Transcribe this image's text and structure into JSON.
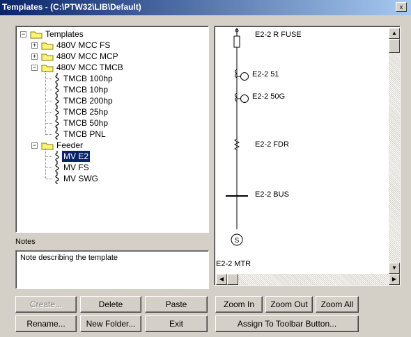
{
  "window": {
    "title": "Templates - (C:\\PTW32\\LIB\\Default)",
    "close_glyph": "x"
  },
  "tree": {
    "root": "Templates",
    "groups": [
      {
        "label": "480V MCC FS",
        "expanded": false,
        "children": []
      },
      {
        "label": "480V MCC MCP",
        "expanded": false,
        "children": []
      },
      {
        "label": "480V MCC TMCB",
        "expanded": true,
        "children": [
          "TMCB 100hp",
          "TMCB 10hp",
          "TMCB 200hp",
          "TMCB 25hp",
          "TMCB 50hp",
          "TMCB PNL"
        ]
      },
      {
        "label": "Feeder",
        "expanded": true,
        "children": [
          "MV E2",
          "MV FS",
          "MV SWG"
        ]
      }
    ],
    "selected": "MV E2"
  },
  "notes": {
    "label": "Notes",
    "text": "Note describing the template"
  },
  "diagram": {
    "labels": {
      "fuse": "E2-2 R FUSE",
      "relay51": "E2-2 51",
      "relay50g": "E2-2 50G",
      "feeder": "E2-2 FDR",
      "bus": "E2-2 BUS",
      "motor": "E2-2 MTR"
    },
    "motor_symbol": "S"
  },
  "buttons": {
    "create": "Create...",
    "delete": "Delete",
    "paste": "Paste",
    "rename": "Rename...",
    "new_folder": "New Folder...",
    "exit": "Exit",
    "zoom_in": "Zoom In",
    "zoom_out": "Zoom Out",
    "zoom_all": "Zoom All",
    "assign_toolbar": "Assign To Toolbar Button..."
  },
  "scroll_arrows": {
    "up": "▲",
    "down": "▼",
    "left": "◀",
    "right": "▶"
  }
}
